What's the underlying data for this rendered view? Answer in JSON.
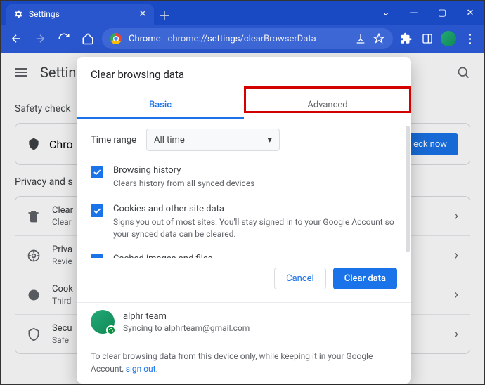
{
  "window": {
    "tab_title": "Settings",
    "new_tab": "＋"
  },
  "urlbar": {
    "chrome_label": "Chrome",
    "separator": " | ",
    "url_prefix": "chrome://",
    "url_mid": "settings",
    "url_suffix": "/clearBrowserData"
  },
  "behind": {
    "title": "Settings",
    "safety_heading": "Safety check",
    "safety_text": "Chro",
    "check_now": "eck now",
    "privacy_heading": "Privacy and s",
    "rows": [
      {
        "title": "Clear",
        "sub": "Clear"
      },
      {
        "title": "Priva",
        "sub": "Revie"
      },
      {
        "title": "Cook",
        "sub": "Third"
      },
      {
        "title": "Secu",
        "sub": "Safe"
      }
    ]
  },
  "dialog": {
    "title": "Clear browsing data",
    "tabs": {
      "basic": "Basic",
      "advanced": "Advanced"
    },
    "time_range_label": "Time range",
    "time_range_value": "All time",
    "items": [
      {
        "title": "Browsing history",
        "sub": "Clears history from all synced devices"
      },
      {
        "title": "Cookies and other site data",
        "sub": "Signs you out of most sites. You'll stay signed in to your Google Account so your synced data can be cleared."
      },
      {
        "title": "Cached images and files",
        "sub": ""
      }
    ],
    "cancel": "Cancel",
    "clear": "Clear data",
    "account": {
      "name": "alphr team",
      "sub": "Syncing to alphrteam@gmail.com"
    },
    "footer_note_pre": "To clear browsing data from this device only, while keeping it in your Google Account, ",
    "footer_link": "sign out",
    "footer_note_post": "."
  }
}
